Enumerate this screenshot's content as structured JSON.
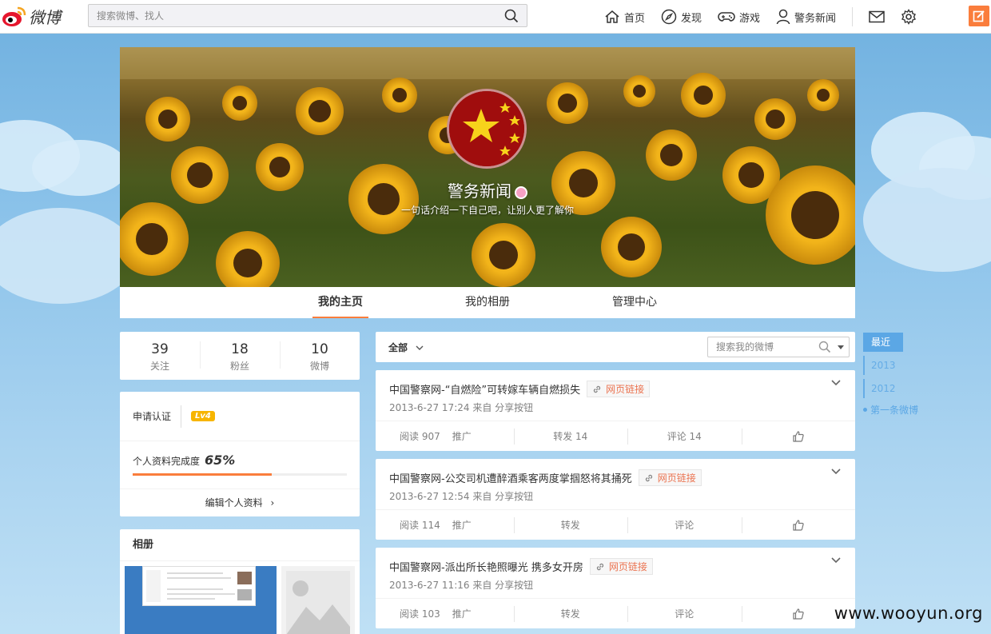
{
  "topbar": {
    "logo_text": "微博",
    "search_placeholder": "搜索微博、找人",
    "nav": [
      {
        "label": "首页",
        "icon": "home-icon"
      },
      {
        "label": "发现",
        "icon": "compass-icon"
      },
      {
        "label": "游戏",
        "icon": "gamepad-icon"
      },
      {
        "label": "警务新闻",
        "icon": "user-icon"
      }
    ]
  },
  "cover": {
    "name": "警务新闻",
    "bio": "一句话介绍一下自己吧，让别人更了解你"
  },
  "tabs": [
    {
      "label": "我的主页",
      "active": true
    },
    {
      "label": "我的相册",
      "active": false
    },
    {
      "label": "管理中心",
      "active": false
    }
  ],
  "stats": [
    {
      "num": "39",
      "label": "关注"
    },
    {
      "num": "18",
      "label": "粉丝"
    },
    {
      "num": "10",
      "label": "微博"
    }
  ],
  "profile": {
    "verify_label": "申请认证",
    "level": "Lv4",
    "complete_label": "个人资料完成度",
    "complete_value": "65%",
    "complete_fraction": 0.65,
    "edit_label": "编辑个人资料"
  },
  "album": {
    "title": "相册"
  },
  "feed": {
    "filter_label": "全部",
    "search_placeholder": "搜索我的微博",
    "link_tag": "网页链接",
    "promote_label": "推广",
    "posts": [
      {
        "title": "中国警察网-“自燃险”可转嫁车辆自燃损失",
        "meta": "2013-6-27 17:24 来自 分享按钮",
        "read": "阅读 907",
        "repost": "转发 14",
        "comment": "评论 14"
      },
      {
        "title": "中国警察网-公交司机遭醉酒乘客两度掌掴怒将其捅死",
        "meta": "2013-6-27 12:54 来自 分享按钮",
        "read": "阅读 114",
        "repost": "转发",
        "comment": "评论"
      },
      {
        "title": "中国警察网-派出所长艳照曝光 携多女开房",
        "meta": "2013-6-27 11:16 来自 分享按钮",
        "read": "阅读 103",
        "repost": "转发",
        "comment": "评论"
      }
    ]
  },
  "timeline": {
    "active": "最近",
    "years": [
      "2013",
      "2012"
    ],
    "first": "第一条微博"
  },
  "watermark": "www.wooyun.org",
  "colors": {
    "accent": "#fa7d3c",
    "link_blue": "#5ba7e5",
    "link_tag": "#eb7350"
  }
}
